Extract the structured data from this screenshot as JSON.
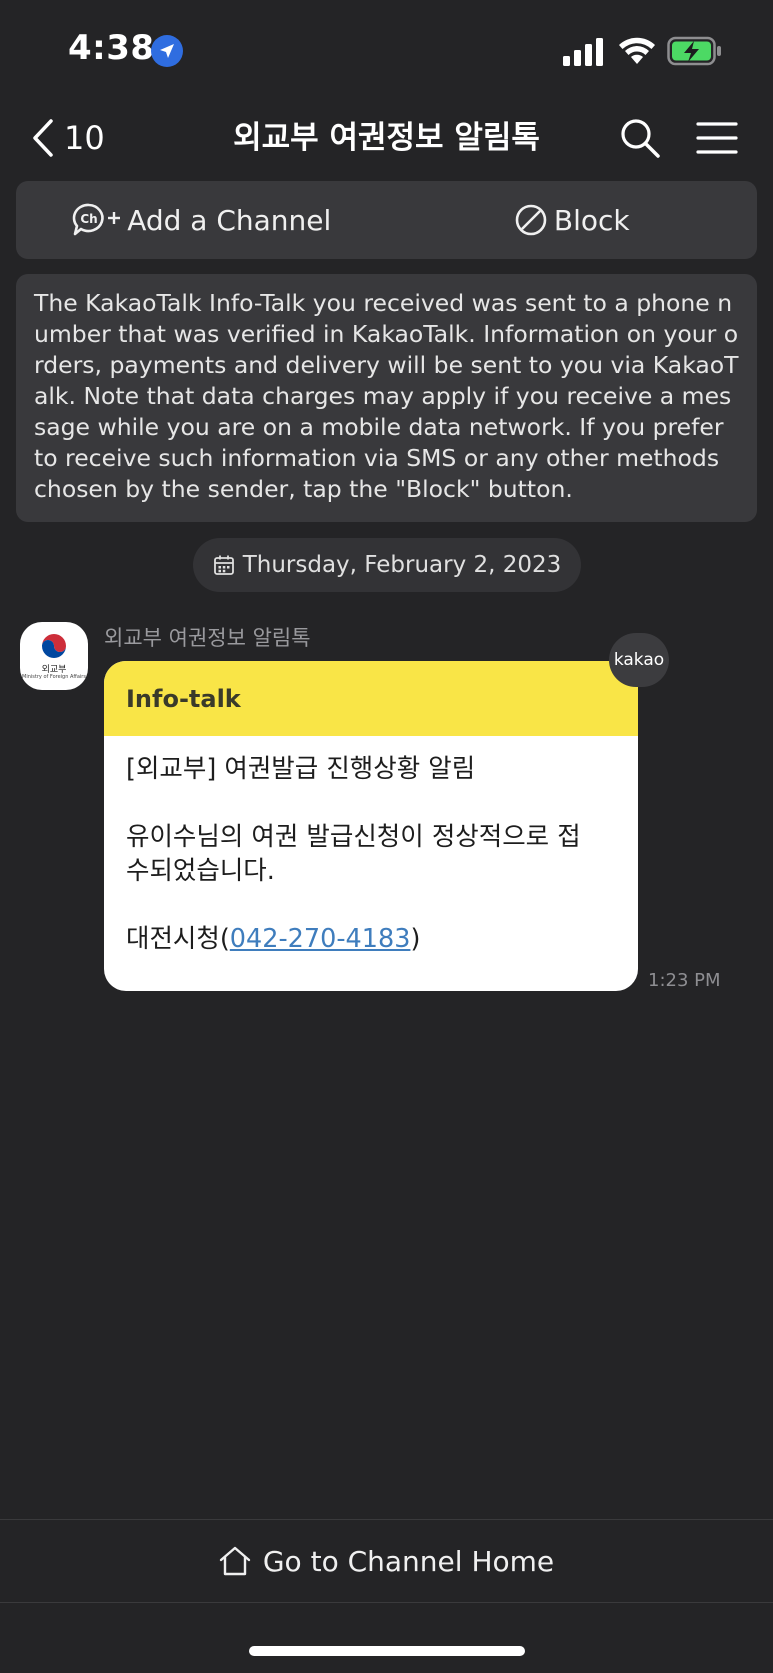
{
  "status_bar": {
    "time": "4:38"
  },
  "nav": {
    "back_count": "10",
    "title": "외교부 여권정보 알림톡"
  },
  "actions": {
    "add_channel_label": "Add a Channel",
    "channel_icon_text": "Ch",
    "block_label": "Block"
  },
  "notice": {
    "text": "The KakaoTalk Info-Talk you received was sent to a phone number that was verified in KakaoTalk. Information on your orders, payments and delivery will be sent to you via KakaoTalk. Note that data charges may apply if you receive a message while you are on a mobile data network. If you prefer to receive such information via SMS or any other methods chosen by the sender, tap the \"Block\" button."
  },
  "date_chip": {
    "label": "Thursday, February 2, 2023"
  },
  "message": {
    "avatar_label": "외교부",
    "avatar_sub": "Ministry of Foreign Affairs",
    "sender": "외교부 여권정보 알림톡",
    "badge": "kakao",
    "header": "Info-talk",
    "line1": "[외교부] 여권발급 진행상황 알림",
    "line2": "유이수님의 여권 발급신청이 정상적으로 접",
    "line3": "수되었습니다.",
    "contact_prefix": "대전시청(",
    "contact_phone": "042-270-4183",
    "contact_suffix": ")",
    "time": "1:23 PM"
  },
  "bottom": {
    "channel_home_label": "Go to Channel Home"
  },
  "colors": {
    "background": "#242426",
    "panel": "#39393c",
    "info_header": "#f9e547",
    "link": "#3f7dbd",
    "battery_fill": "#4cd964"
  },
  "icons": {
    "location": "location-arrow-icon",
    "signal": "cellular-signal-icon",
    "wifi": "wifi-icon",
    "battery": "battery-charging-icon",
    "back": "chevron-left-icon",
    "search": "search-icon",
    "menu": "hamburger-menu-icon",
    "add_channel": "channel-add-icon",
    "block": "block-icon",
    "calendar": "calendar-icon",
    "home": "home-icon"
  }
}
